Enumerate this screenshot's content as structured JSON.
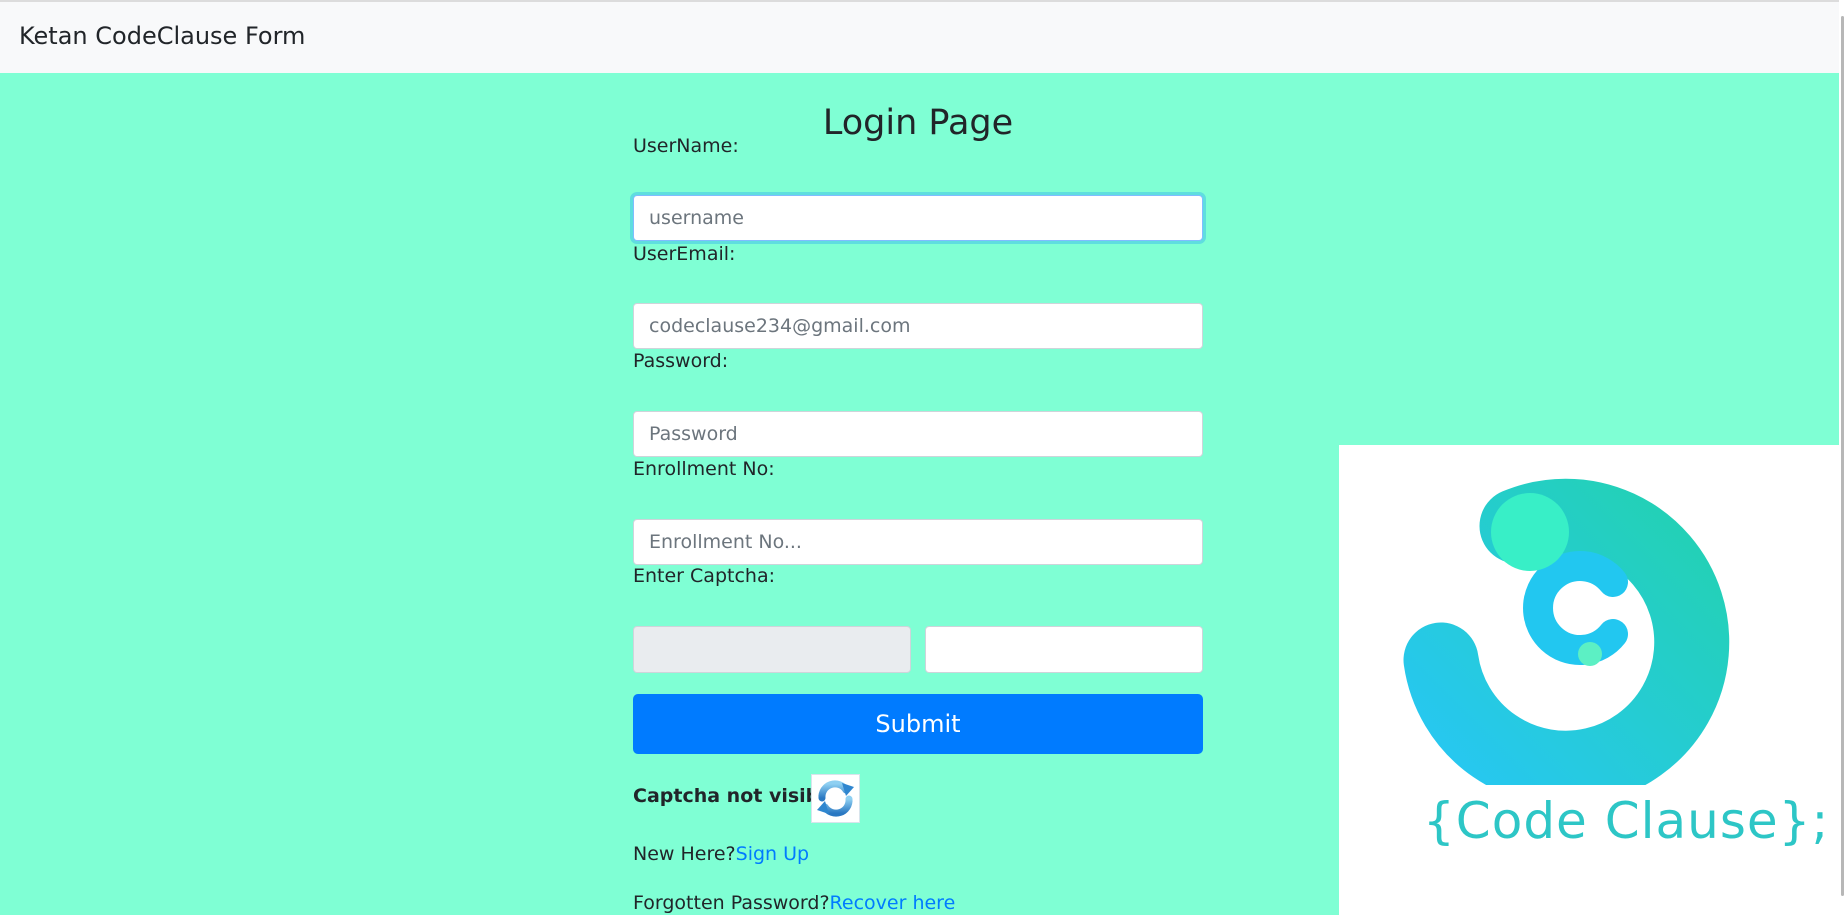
{
  "navbar": {
    "brand": "Ketan CodeClause Form"
  },
  "form": {
    "title": "Login Page",
    "username": {
      "label": "UserName:",
      "placeholder": "username"
    },
    "email": {
      "label": "UserEmail:",
      "placeholder": "codeclause234@gmail.com"
    },
    "password": {
      "label": "Password:",
      "placeholder": "Password"
    },
    "enrollment": {
      "label": "Enrollment No:",
      "placeholder": "Enrollment No..."
    },
    "captcha": {
      "label": "Enter Captcha:"
    },
    "submit_label": "Submit",
    "captcha_note": "Captcha not visible",
    "signup": {
      "prefix": "New Here?",
      "link": "Sign Up"
    },
    "recover": {
      "prefix": "Forgotten Password?",
      "link": "Recover here"
    }
  },
  "logo": {
    "wordmark": "{Code Clause};"
  },
  "colors": {
    "page_background": "#7fffd4",
    "navbar_background": "#f8f9fa",
    "primary": "#007bff"
  },
  "icons": {
    "refresh": "refresh-icon",
    "logo": "code-clause-logo"
  }
}
